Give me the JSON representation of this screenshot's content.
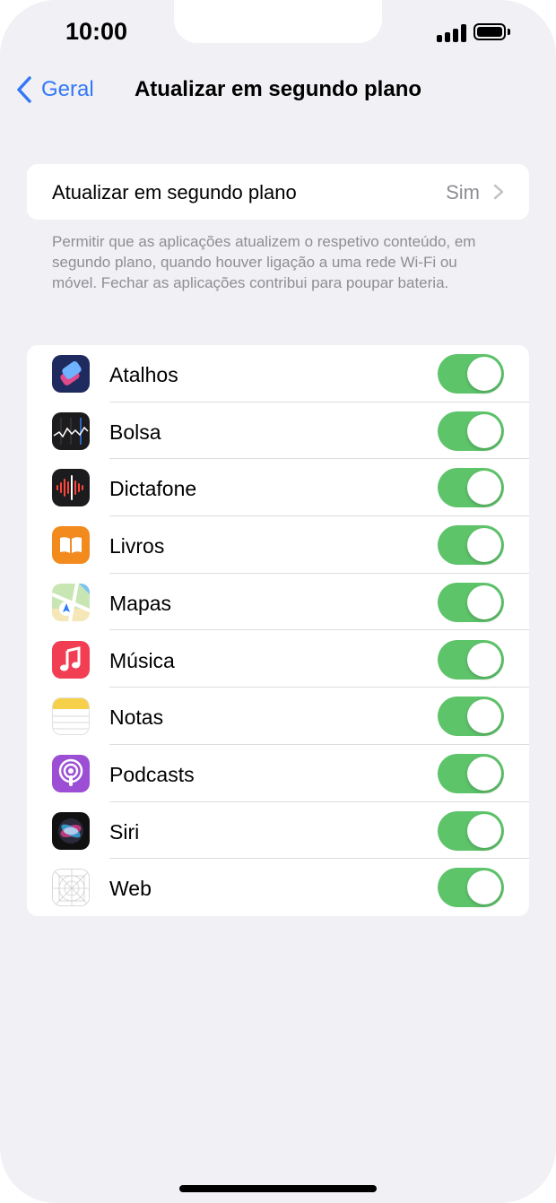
{
  "status_bar": {
    "time": "10:00"
  },
  "nav": {
    "back_label": "Geral",
    "title": "Atualizar em segundo plano"
  },
  "setting": {
    "label": "Atualizar em segundo plano",
    "value": "Sim"
  },
  "footer": "Permitir que as aplicações atualizem o respetivo conteúdo, em segundo plano, quando houver ligação a uma rede Wi-Fi ou móvel. Fechar as aplicações contribui para poupar bateria.",
  "apps": [
    {
      "name": "Atalhos",
      "icon": "shortcuts-icon",
      "enabled": true
    },
    {
      "name": "Bolsa",
      "icon": "stocks-icon",
      "enabled": true
    },
    {
      "name": "Dictafone",
      "icon": "voice-memos-icon",
      "enabled": true
    },
    {
      "name": "Livros",
      "icon": "books-icon",
      "enabled": true
    },
    {
      "name": "Mapas",
      "icon": "maps-icon",
      "enabled": true
    },
    {
      "name": "Música",
      "icon": "music-icon",
      "enabled": true
    },
    {
      "name": "Notas",
      "icon": "notes-icon",
      "enabled": true
    },
    {
      "name": "Podcasts",
      "icon": "podcasts-icon",
      "enabled": true
    },
    {
      "name": "Siri",
      "icon": "siri-icon",
      "enabled": true
    },
    {
      "name": "Web",
      "icon": "web-app-icon",
      "enabled": true
    }
  ],
  "colors": {
    "accent": "#3478f6",
    "toggle_on": "#5ec46a",
    "background": "#f0f0f5",
    "secondary_text": "#8e8e93"
  }
}
